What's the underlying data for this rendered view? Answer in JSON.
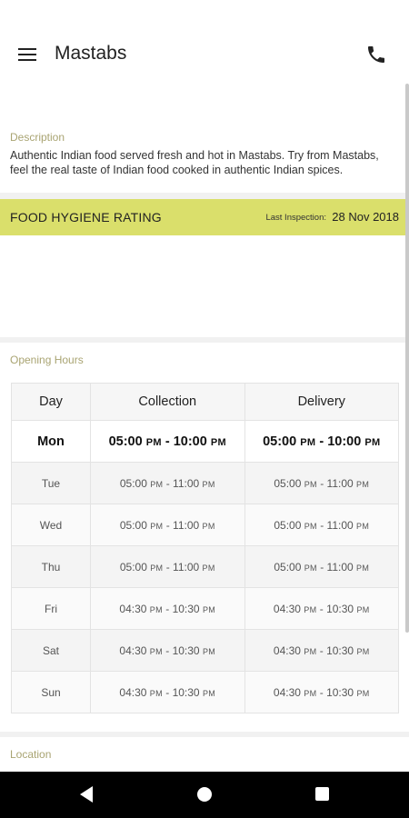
{
  "appbar": {
    "title": "Mastabs",
    "menu_icon": "hamburger-menu-icon",
    "call_icon": "phone-icon"
  },
  "description": {
    "label": "Description",
    "text": "Authentic Indian food served fresh and hot in Mastabs. Try from Mastabs, feel the real taste of Indian food cooked in authentic Indian spices."
  },
  "hygiene": {
    "title": "FOOD HYGIENE RATING",
    "last_inspection_label": "Last Inspection:",
    "last_inspection_date": "28 Nov 2018",
    "bar_color": "#dadf6b"
  },
  "opening_hours": {
    "label": "Opening Hours",
    "columns": [
      "Day",
      "Collection",
      "Delivery"
    ],
    "rows": [
      {
        "day": "Mon",
        "collection": {
          "from": "05:00",
          "from_period": "PM",
          "to": "10:00",
          "to_period": "PM"
        },
        "delivery": {
          "from": "05:00",
          "from_period": "PM",
          "to": "10:00",
          "to_period": "PM"
        }
      },
      {
        "day": "Tue",
        "collection": {
          "from": "05:00",
          "from_period": "PM",
          "to": "11:00",
          "to_period": "PM"
        },
        "delivery": {
          "from": "05:00",
          "from_period": "PM",
          "to": "11:00",
          "to_period": "PM"
        }
      },
      {
        "day": "Wed",
        "collection": {
          "from": "05:00",
          "from_period": "PM",
          "to": "11:00",
          "to_period": "PM"
        },
        "delivery": {
          "from": "05:00",
          "from_period": "PM",
          "to": "11:00",
          "to_period": "PM"
        }
      },
      {
        "day": "Thu",
        "collection": {
          "from": "05:00",
          "from_period": "PM",
          "to": "11:00",
          "to_period": "PM"
        },
        "delivery": {
          "from": "05:00",
          "from_period": "PM",
          "to": "11:00",
          "to_period": "PM"
        }
      },
      {
        "day": "Fri",
        "collection": {
          "from": "04:30",
          "from_period": "PM",
          "to": "10:30",
          "to_period": "PM"
        },
        "delivery": {
          "from": "04:30",
          "from_period": "PM",
          "to": "10:30",
          "to_period": "PM"
        }
      },
      {
        "day": "Sat",
        "collection": {
          "from": "04:30",
          "from_period": "PM",
          "to": "10:30",
          "to_period": "PM"
        },
        "delivery": {
          "from": "04:30",
          "from_period": "PM",
          "to": "10:30",
          "to_period": "PM"
        }
      },
      {
        "day": "Sun",
        "collection": {
          "from": "04:30",
          "from_period": "PM",
          "to": "10:30",
          "to_period": "PM"
        },
        "delivery": {
          "from": "04:30",
          "from_period": "PM",
          "to": "10:30",
          "to_period": "PM"
        }
      }
    ]
  },
  "location": {
    "label": "Location"
  },
  "nav": {
    "back_icon": "back-triangle-icon",
    "home_icon": "home-circle-icon",
    "recents_icon": "recents-square-icon"
  },
  "colors": {
    "accent_label": "#a9a472",
    "background": "#f1f1f1"
  }
}
